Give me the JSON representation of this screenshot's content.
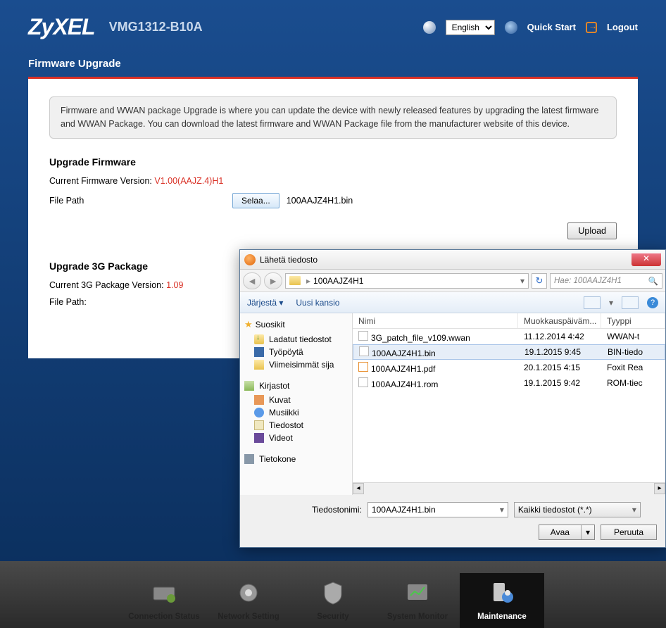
{
  "header": {
    "logo": "ZyXEL",
    "model": "VMG1312-B10A",
    "language": "English",
    "quickstart_label": "Quick Start",
    "logout_label": "Logout"
  },
  "page": {
    "title": "Firmware Upgrade",
    "info_text": "Firmware and WWAN package Upgrade is where you can update the device with newly released features by upgrading the latest firmware and WWAN Package. You can download the latest firmware and WWAN Package file from the manufacturer website of this device."
  },
  "firmware": {
    "section_title": "Upgrade Firmware",
    "version_label": "Current Firmware Version:",
    "version_value": "V1.00(AAJZ.4)H1",
    "filepath_label": "File Path",
    "browse_label": "Selaa...",
    "selected_file": "100AAJZ4H1.bin",
    "upload_label": "Upload"
  },
  "pkg3g": {
    "section_title": "Upgrade 3G Package",
    "version_label": "Current 3G Package Version:",
    "version_value": "1.09",
    "filepath_label": "File Path:"
  },
  "nav": {
    "items": [
      "Connection Status",
      "Network Setting",
      "Security",
      "System Monitor",
      "Maintenance"
    ]
  },
  "dialog": {
    "title": "Lähetä tiedosto",
    "path": "100AAJZ4H1",
    "search_placeholder": "Hae: 100AAJZ4H1",
    "organize": "Järjestä",
    "newfolder": "Uusi kansio",
    "side": {
      "fav": "Suosikit",
      "downloads": "Ladatut tiedostot",
      "desktop": "Työpöytä",
      "recent": "Viimeisimmät sija",
      "libraries": "Kirjastot",
      "pictures": "Kuvat",
      "music": "Musiikki",
      "documents": "Tiedostot",
      "videos": "Videot",
      "computer": "Tietokone"
    },
    "cols": {
      "name": "Nimi",
      "date": "Muokkauspäiväm...",
      "type": "Tyyppi"
    },
    "files": [
      {
        "name": "3G_patch_file_v109.wwan",
        "date": "11.12.2014 4:42",
        "type": "WWAN-t"
      },
      {
        "name": "100AAJZ4H1.bin",
        "date": "19.1.2015 9:45",
        "type": "BIN-tiedo"
      },
      {
        "name": "100AAJZ4H1.pdf",
        "date": "20.1.2015 4:15",
        "type": "Foxit Rea"
      },
      {
        "name": "100AAJZ4H1.rom",
        "date": "19.1.2015 9:42",
        "type": "ROM-tiec"
      }
    ],
    "filename_label": "Tiedostonimi:",
    "filename_value": "100AAJZ4H1.bin",
    "filter": "Kaikki tiedostot (*.*)",
    "open": "Avaa",
    "cancel": "Peruuta"
  }
}
